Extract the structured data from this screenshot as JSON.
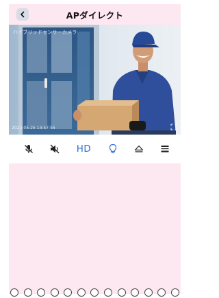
{
  "header": {
    "title": "APダイレクト",
    "back_icon": "chevron-left-icon"
  },
  "video": {
    "camera_name": "ハイブリッドセンサーカメラ",
    "timestamp": "2022-05-25  13:57:55",
    "fullscreen_icon": "fullscreen-icon"
  },
  "controls": {
    "items": [
      {
        "icon": "mic-off-icon",
        "label": ""
      },
      {
        "icon": "speaker-off-icon",
        "label": ""
      },
      {
        "icon": "hd-quality",
        "label": "HD"
      },
      {
        "icon": "light-bulb-icon",
        "label": ""
      },
      {
        "icon": "eject-icon",
        "label": ""
      },
      {
        "icon": "menu-bars-icon",
        "label": ""
      }
    ],
    "accent_color": "#2b6fd6"
  },
  "colors": {
    "panel_pink": "#fde7f1",
    "accent_blue": "#2b6fd6"
  }
}
